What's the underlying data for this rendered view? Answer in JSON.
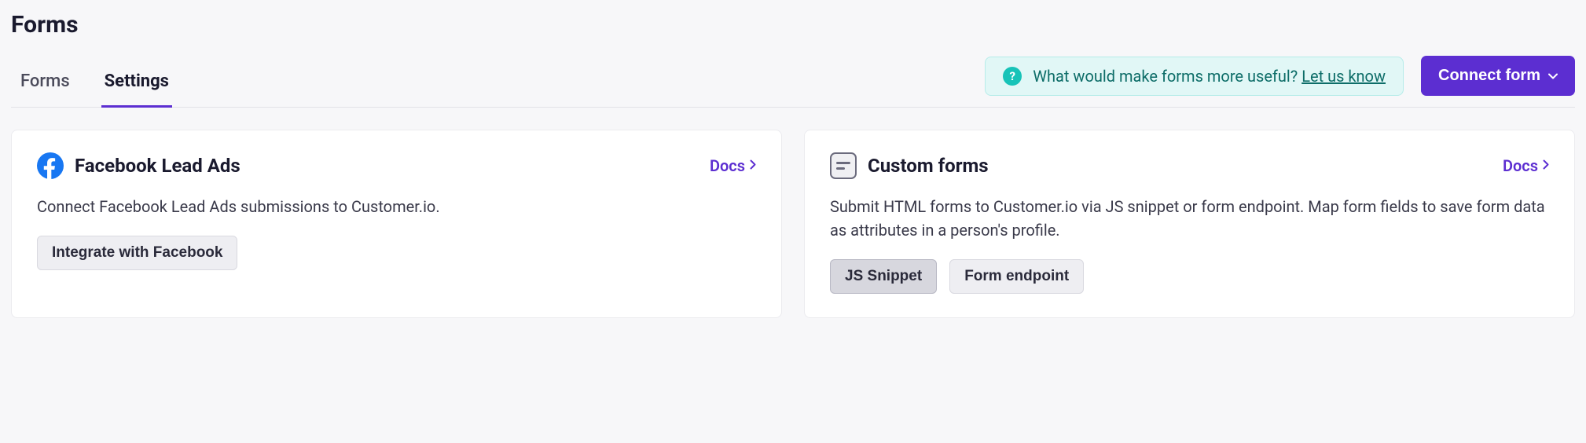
{
  "page_title": "Forms",
  "tabs": {
    "forms": "Forms",
    "settings": "Settings"
  },
  "feedback": {
    "text": "What would make forms more useful? ",
    "link": "Let us know"
  },
  "connect_button": "Connect form",
  "cards": {
    "facebook": {
      "title": "Facebook Lead Ads",
      "docs_label": "Docs",
      "description": "Connect Facebook Lead Ads submissions to Customer.io.",
      "button": "Integrate with Facebook"
    },
    "custom": {
      "title": "Custom forms",
      "docs_label": "Docs",
      "description": "Submit HTML forms to Customer.io via JS snippet or form endpoint. Map form fields to save form data as attributes in a person's profile.",
      "button_js": "JS Snippet",
      "button_endpoint": "Form endpoint"
    }
  }
}
